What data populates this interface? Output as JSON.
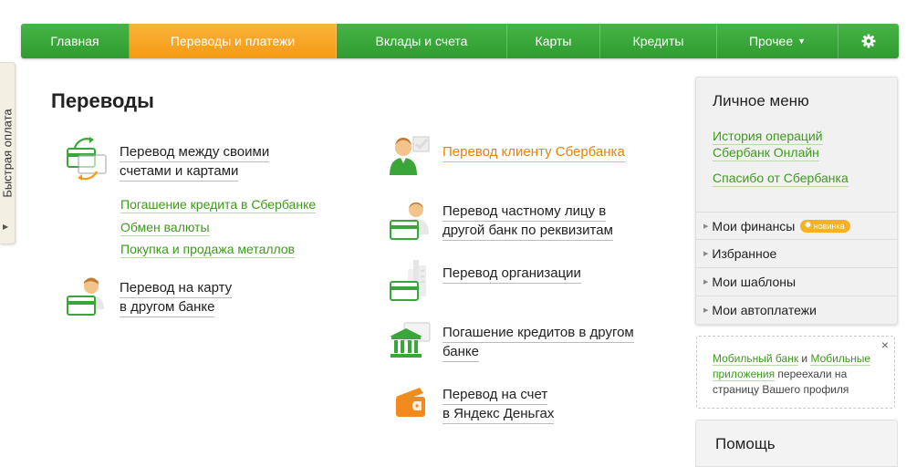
{
  "side_tab": {
    "label": "Быстрая оплата"
  },
  "nav": {
    "items": [
      {
        "label": "Главная",
        "width": 119
      },
      {
        "label": "Переводы и платежи",
        "width": 227,
        "active": true
      },
      {
        "label": "Вклады и счета",
        "width": 187
      },
      {
        "label": "Карты",
        "width": 102
      },
      {
        "label": "Кредиты",
        "width": 128
      },
      {
        "label": "Прочее",
        "width": 133
      }
    ],
    "settings_icon": "gear-icon"
  },
  "page_title": "Переводы",
  "services": {
    "own_accounts": {
      "line1": "Перевод между своими",
      "line2": "счетами и картами"
    },
    "sub_links": [
      "Погашение кредита в Сбербанке",
      "Обмен валюты",
      "Покупка и продажа металлов"
    ],
    "card_other_bank": {
      "line1": "Перевод на карту",
      "line2": "в другом банке"
    },
    "sber_client": {
      "line1": "Перевод клиенту Сбербанка"
    },
    "private_person": {
      "line1": "Перевод частному лицу в",
      "line2": "другой банк по реквизитам"
    },
    "organization": {
      "line1": "Перевод организации"
    },
    "loan_other_bank": {
      "line1": "Погашение кредитов в другом",
      "line2": "банке"
    },
    "yandex": {
      "line1": "Перевод на счет",
      "line2": "в Яндекс Деньгах"
    }
  },
  "personal_menu": {
    "title": "Личное меню",
    "links": [
      {
        "line1": "История операций",
        "line2": "Сбербанк Онлайн"
      },
      {
        "line1": "Спасибо от Сбербанка"
      }
    ],
    "items": [
      "Мои финансы",
      "Избранное",
      "Мои шаблоны",
      "Мои автоплатежи"
    ],
    "badge": "новинка"
  },
  "notice": {
    "link1": "Мобильный банк",
    "and": " и ",
    "link2": "Мобильные приложения",
    "rest": " переехали на страницу Вашего профиля",
    "close": "×"
  },
  "help": {
    "title": "Помощь"
  },
  "colors": {
    "green": "#3d9b1c",
    "orange": "#f59a14",
    "nav_green": "#2f9b30"
  }
}
